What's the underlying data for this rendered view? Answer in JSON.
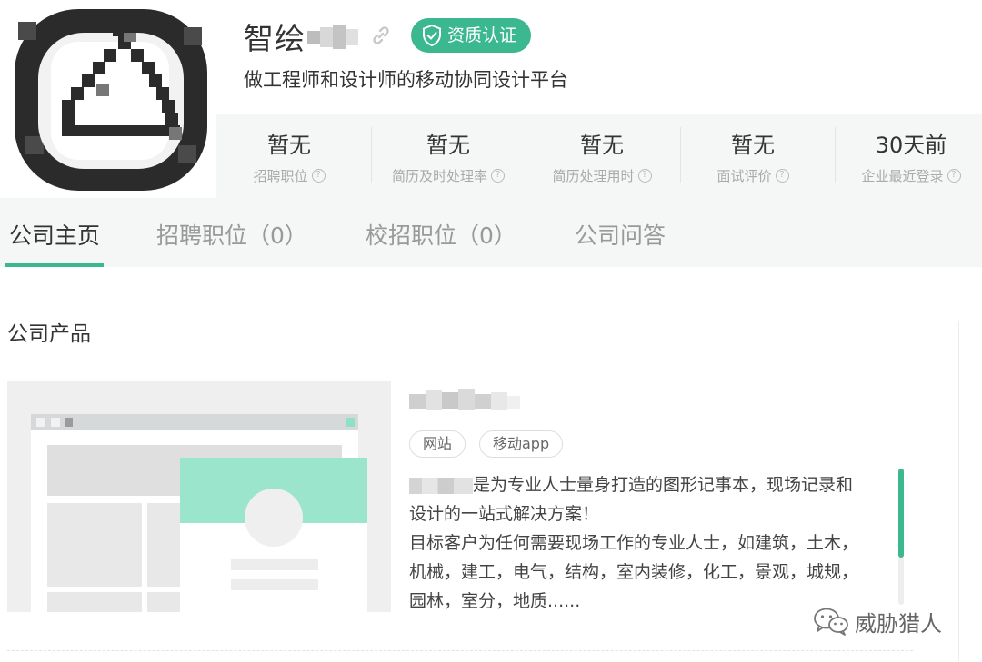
{
  "header": {
    "company_name": "智绘",
    "cert_label": "资质认证",
    "slogan": "做工程师和设计师的移动协同设计平台"
  },
  "stats": [
    {
      "value": "暂无",
      "label": "招聘职位"
    },
    {
      "value": "暂无",
      "label": "简历及时处理率"
    },
    {
      "value": "暂无",
      "label": "简历处理用时"
    },
    {
      "value": "暂无",
      "label": "面试评价"
    },
    {
      "value": "30天前",
      "label": "企业最近登录"
    }
  ],
  "tabs": [
    {
      "label": "公司主页"
    },
    {
      "label": "招聘职位（0）"
    },
    {
      "label": "校招职位（0）"
    },
    {
      "label": "公司问答"
    }
  ],
  "products_section": {
    "title": "公司产品",
    "tags": [
      "网站",
      "移动app"
    ],
    "desc_line1": "是为专业人士量身打造的图形记事本，现场记录和",
    "desc_line2": "设计的一站式解决方案！",
    "desc_line3": "目标客户为任何需要现场工作的专业人士，如建筑，土木，",
    "desc_line4": "机械，建工，电气，结构，室内装修，化工，景观，城规，",
    "desc_line5": "园林，室分，地质......"
  },
  "watermark": {
    "text": "威胁猎人"
  },
  "colors": {
    "accent": "#3cb890",
    "stats_bg": "#f5f6f6",
    "muted_text": "#aaaaaa"
  }
}
